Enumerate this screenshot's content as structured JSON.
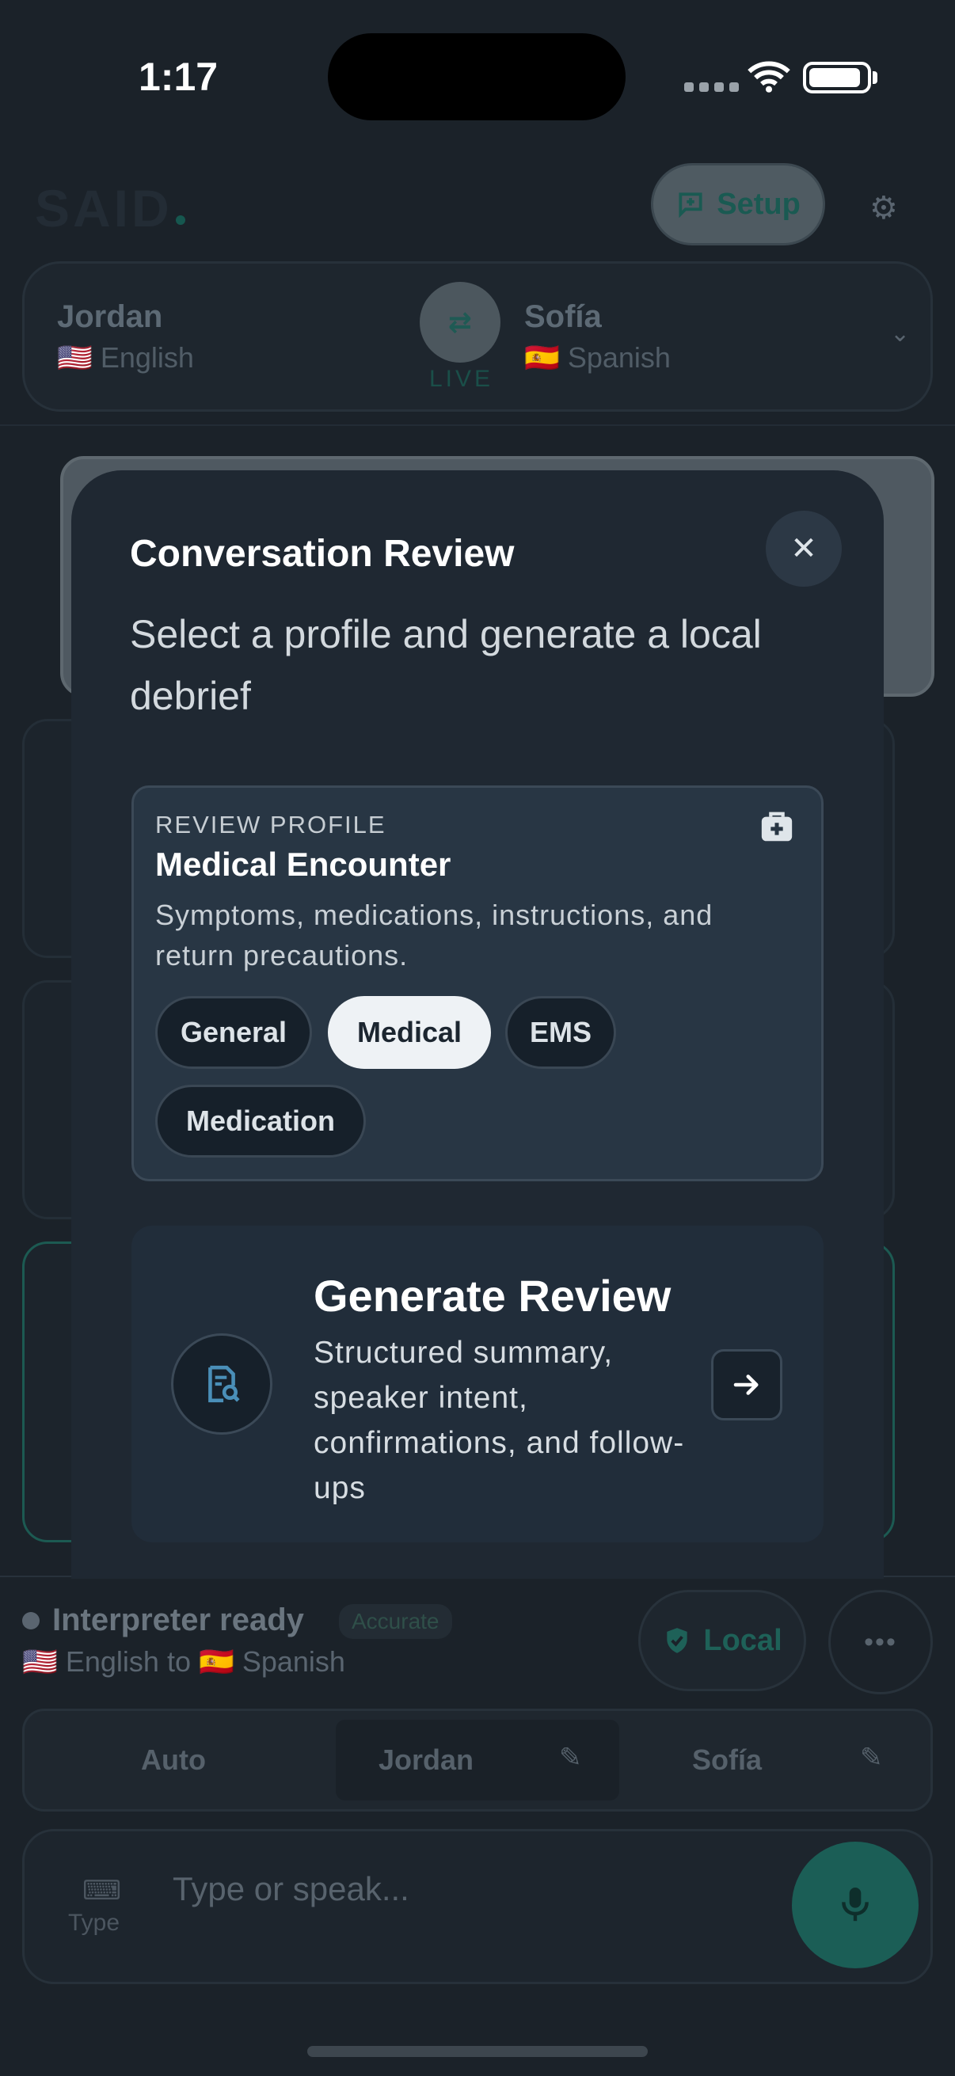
{
  "status_bar": {
    "time": "1:17"
  },
  "app": {
    "logo": "SAID",
    "setup_label": "Setup",
    "speaker_a": {
      "name": "Jordan",
      "flag": "🇺🇸",
      "language": "English"
    },
    "speaker_b": {
      "name": "Sofía",
      "flag": "🇪🇸",
      "language": "Spanish"
    },
    "live_label": "LIVE"
  },
  "modal": {
    "title": "Conversation Review",
    "subtitle": "Select a profile and generate a local debrief",
    "profile": {
      "eyebrow": "REVIEW PROFILE",
      "title": "Medical Encounter",
      "description": "Symptoms, medications, instructions, and return precautions.",
      "chips": [
        "General",
        "Medical",
        "EMS",
        "Medication"
      ],
      "selected": "Medical"
    },
    "generate": {
      "title": "Generate Review",
      "description": "Structured summary, speaker intent, confirmations, and follow-ups"
    }
  },
  "bottom": {
    "interpreter_status": "Interpreter ready",
    "mode_badge": "Accurate",
    "direction": {
      "from_flag": "🇺🇸",
      "from": "English",
      "to_flag": "🇪🇸",
      "to": "Spanish",
      "connector": "to"
    },
    "local_label": "Local",
    "speakers": [
      "Auto",
      "Jordan",
      "Sofía"
    ],
    "type_label": "Type",
    "input_placeholder": "Type or speak..."
  },
  "colors": {
    "accent": "#1b5e56",
    "modal_bg": "#1f2832",
    "selected_chip": "#eef2f5"
  }
}
